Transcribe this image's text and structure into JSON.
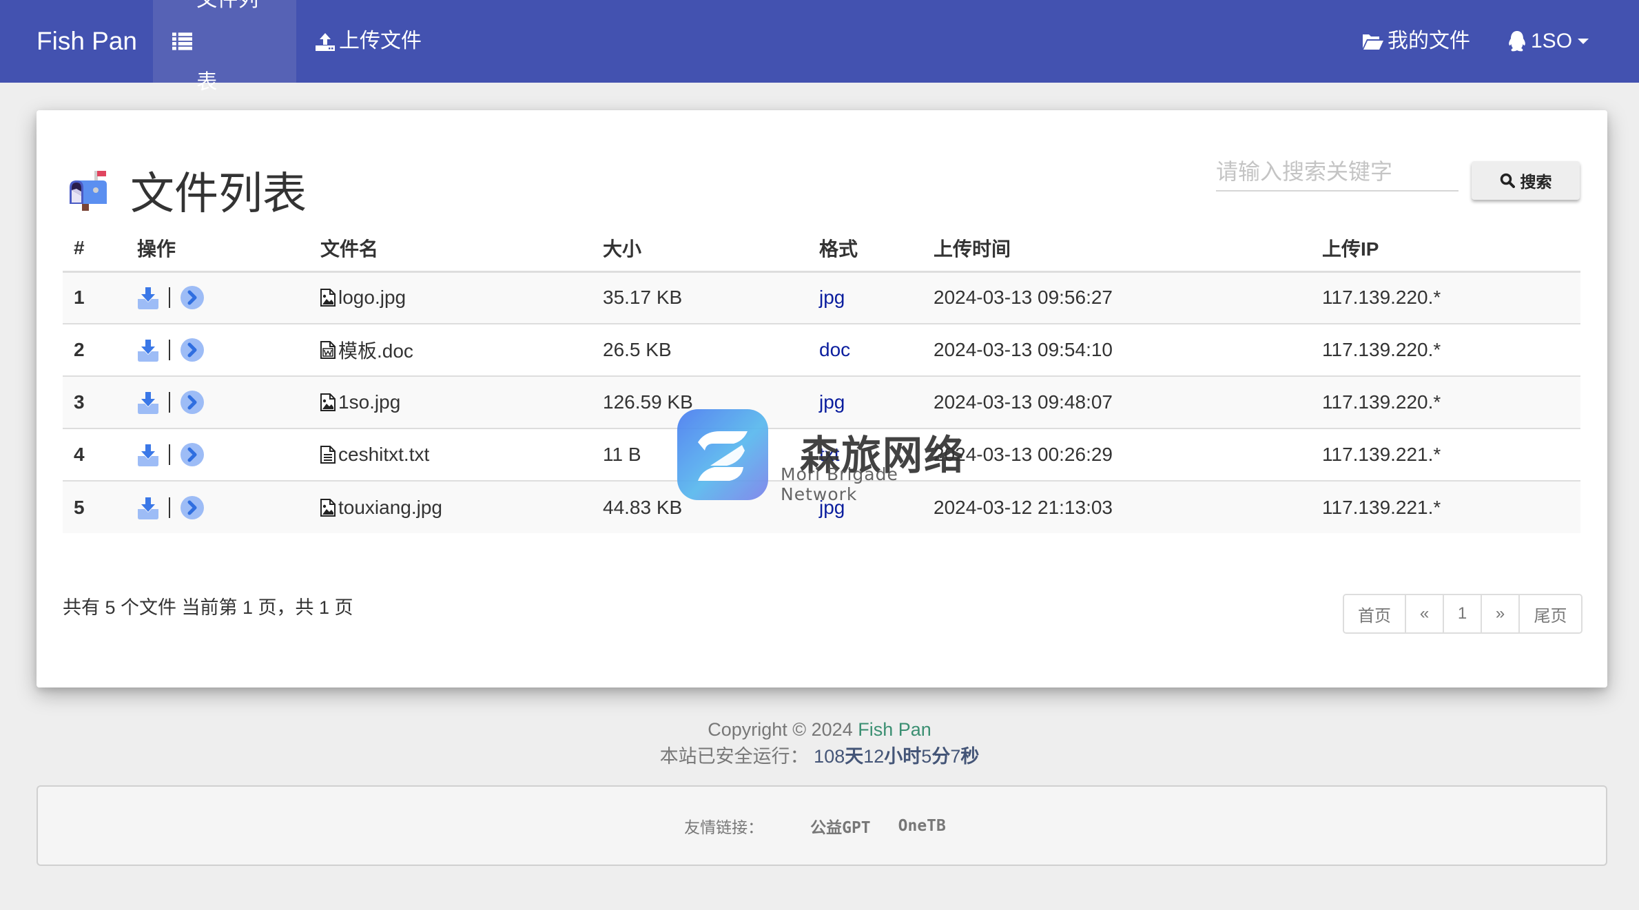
{
  "navbar": {
    "brand": "Fish Pan",
    "items": [
      {
        "label": "文件列表",
        "icon": "list-icon",
        "active": true
      },
      {
        "label": "上传文件",
        "icon": "upload-icon",
        "active": false
      }
    ],
    "right": {
      "my_files": {
        "label": "我的文件",
        "icon": "folder-open-icon"
      },
      "user": {
        "label": "1SO",
        "icon": "qq-penguin-icon"
      }
    }
  },
  "panel": {
    "title": "文件列表",
    "title_icon": "mailbox-icon",
    "search": {
      "placeholder": "请输入搜索关键字",
      "value": "",
      "button_label": "搜索"
    }
  },
  "table": {
    "columns": [
      "#",
      "操作",
      "文件名",
      "大小",
      "格式",
      "上传时间",
      "上传IP"
    ],
    "rows": [
      {
        "num": "1",
        "name": "logo.jpg",
        "file_icon": "image-file-icon",
        "size": "35.17 KB",
        "format": "jpg",
        "time": "2024-03-13 09:56:27",
        "ip": "117.139.220.*"
      },
      {
        "num": "2",
        "name": "模板.doc",
        "file_icon": "word-file-icon",
        "size": "26.5 KB",
        "format": "doc",
        "time": "2024-03-13 09:54:10",
        "ip": "117.139.220.*"
      },
      {
        "num": "3",
        "name": "1so.jpg",
        "file_icon": "image-file-icon",
        "size": "126.59 KB",
        "format": "jpg",
        "time": "2024-03-13 09:48:07",
        "ip": "117.139.220.*"
      },
      {
        "num": "4",
        "name": "ceshitxt.txt",
        "file_icon": "text-file-icon",
        "size": "11 B",
        "format": "txt",
        "time": "2024-03-13 00:26:29",
        "ip": "117.139.221.*"
      },
      {
        "num": "5",
        "name": "touxiang.jpg",
        "file_icon": "image-file-icon",
        "size": "44.83 KB",
        "format": "jpg",
        "time": "2024-03-12 21:13:03",
        "ip": "117.139.221.*"
      }
    ]
  },
  "summary": "共有 5 个文件  当前第 1 页，共 1 页",
  "pagination": {
    "first": "首页",
    "prev": "«",
    "current": "1",
    "next": "»",
    "last": "尾页"
  },
  "footer": {
    "copyright_prefix": "Copyright © 2024 ",
    "brand": "Fish Pan",
    "uptime_label": "本站已安全运行：",
    "uptime": {
      "days": "108",
      "days_unit": "天",
      "hours": "12",
      "hours_unit": "小时",
      "minutes": "5",
      "minutes_unit": "分",
      "seconds": "7",
      "seconds_unit": "秒"
    }
  },
  "friend_links": {
    "label": "友情链接：",
    "links": [
      "公益GPT",
      "OneTB"
    ]
  },
  "watermark": {
    "title": "森旅网络",
    "subtitle": "Mori Brigade Network"
  },
  "colors": {
    "navbar": "#4352b0",
    "navbar_active": "#5662b5",
    "format_link": "#0b1e9e",
    "footer_brand": "#3b8f72",
    "icon_blue": "#3b78e7",
    "icon_blue_light": "#9dbcf6"
  }
}
